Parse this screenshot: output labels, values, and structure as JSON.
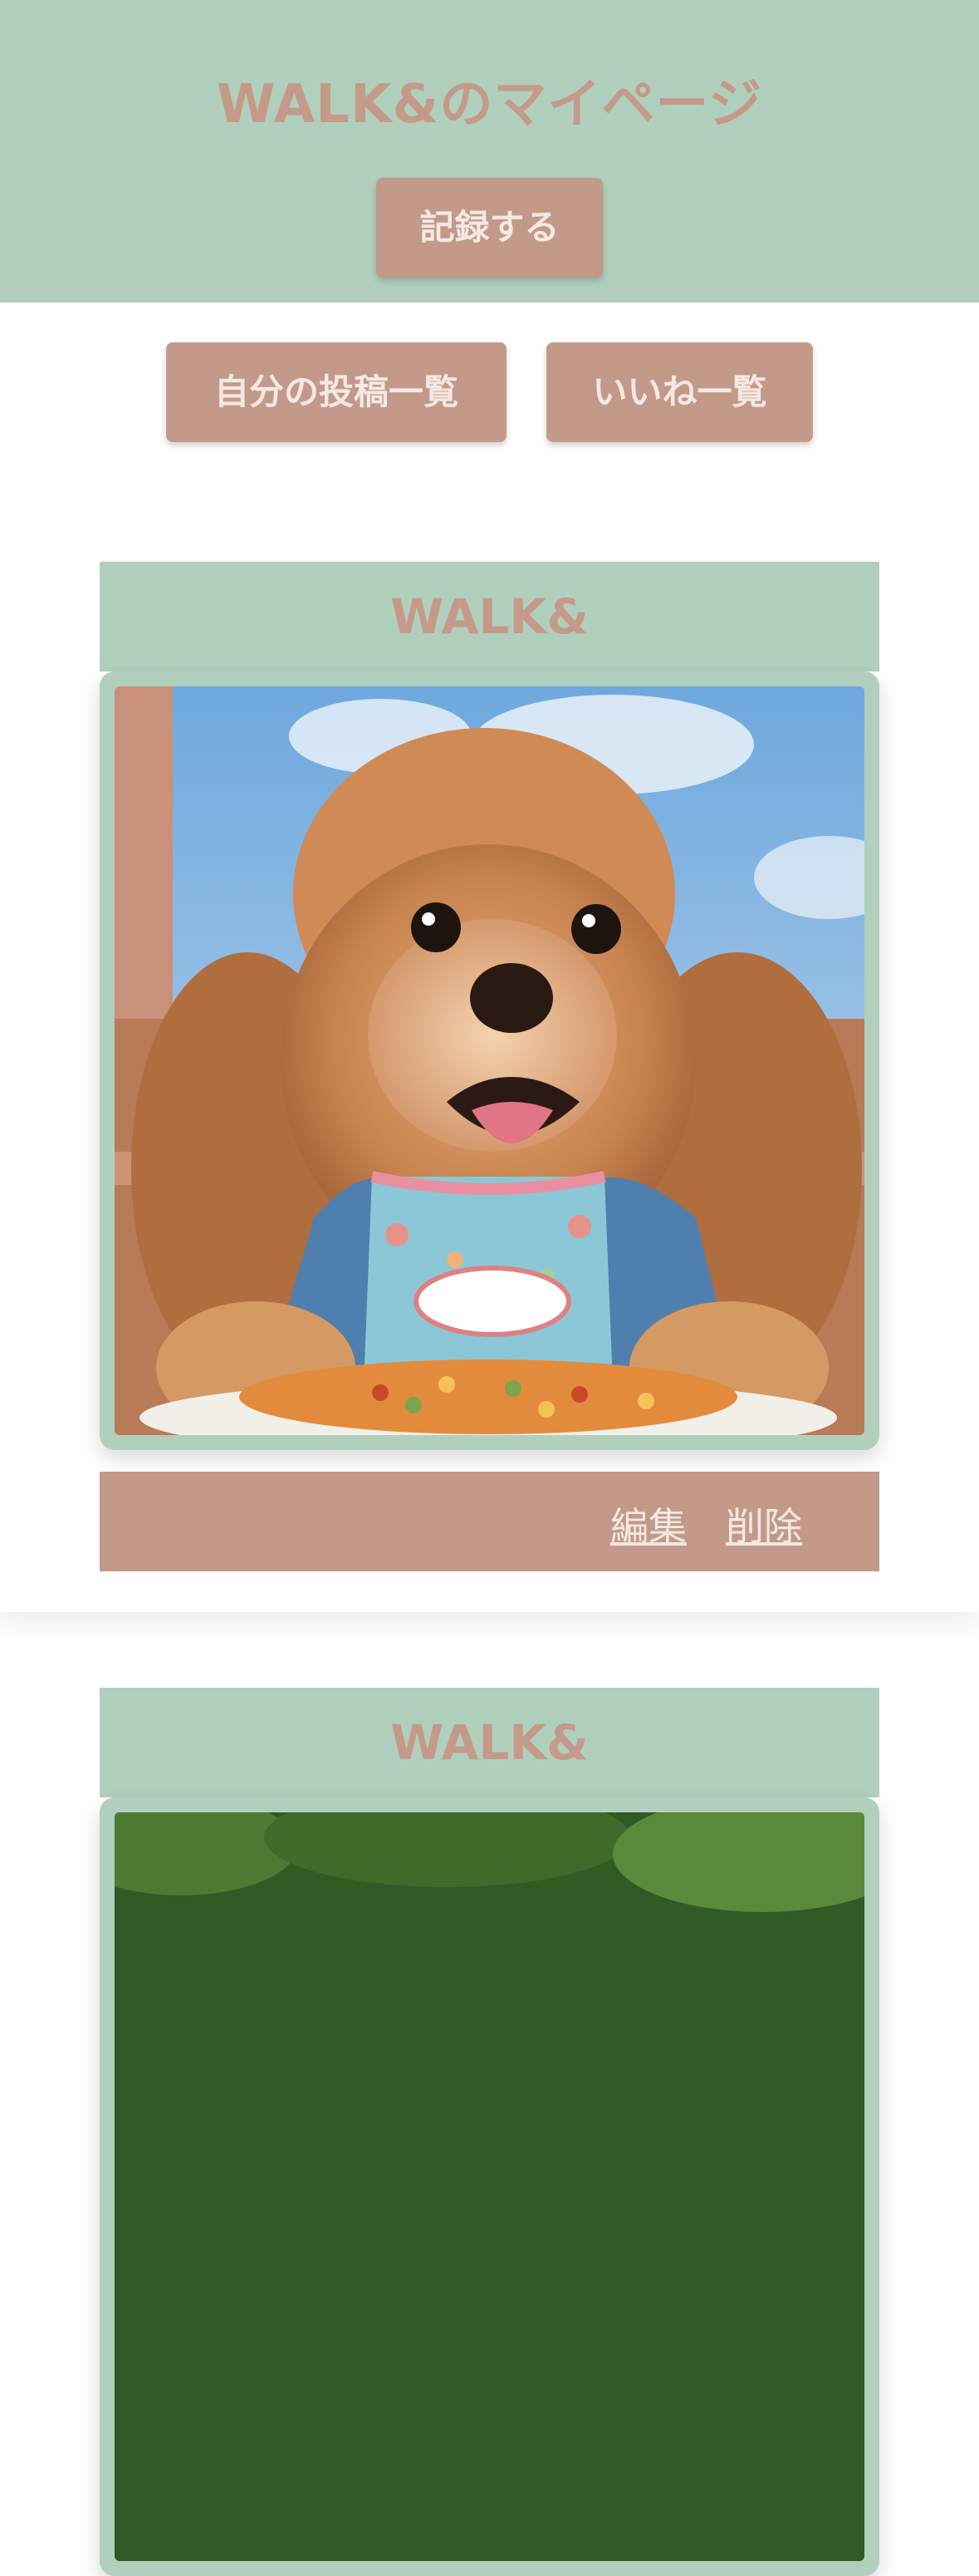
{
  "header": {
    "title": "WALK&のマイページ",
    "record_button": "記録する"
  },
  "nav": {
    "my_posts_button": "自分の投稿一覧",
    "likes_button": "いいね一覧"
  },
  "posts": [
    {
      "title": "WALK&",
      "image": "poodle-with-meal-photo",
      "edit_label": "編集",
      "delete_label": "削除"
    },
    {
      "title": "WALK&",
      "image": "green-trees-photo"
    }
  ],
  "colors": {
    "header_bg": "#b1cfbd",
    "accent": "#c39a89",
    "title_text": "#c59a88",
    "button_text": "#f4e8e2"
  }
}
